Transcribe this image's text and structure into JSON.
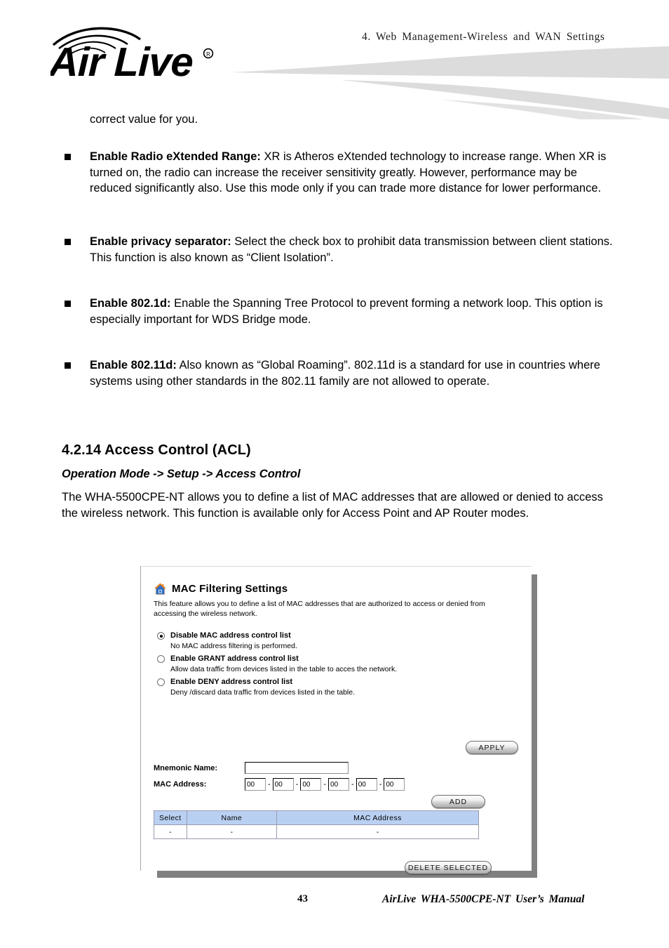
{
  "header": {
    "chapter_title": "4.  Web  Management-Wireless  and  WAN  Settings",
    "logo_text": "Air Live",
    "logo_mark": "registered-trademark"
  },
  "body": {
    "lead_paragraph": "correct value for you.",
    "bullets": [
      {
        "term": "Enable Radio eXtended Range",
        "separator": ":",
        "text": "   XR is Atheros eXtended technology to increase range.    When XR is turned on, the radio can increase the receiver sensitivity greatly. However, performance may be reduced significantly also.    Use this mode only if you can trade more distance for lower performance."
      },
      {
        "term": "Enable privacy separator:",
        "separator": "",
        "text": "   Select the check box to prohibit data transmission between client stations.    This function is also known as “Client Isolation”."
      },
      {
        "term": "Enable 802.1d:",
        "separator": "",
        "text": " Enable the Spanning Tree Protocol to prevent forming a network loop. This option is especially important for WDS Bridge mode."
      },
      {
        "term": "Enable 802.11d:",
        "separator": "",
        "text": "   Also known as “Global Roaming”.    802.11d is a standard for use in countries where systems using other standards in the 802.11 family are not allowed to operate."
      }
    ],
    "section_heading": "4.2.14 Access Control (ACL)",
    "section_subheading": "Operation Mode -> Setup -> Access Control",
    "section_paragraph": "The WHA-5500CPE-NT allows you to define a list of MAC addresses that are allowed or denied to access the wireless network.    This function is available only for Access Point and AP Router modes."
  },
  "screenshot": {
    "icon": "house-icon",
    "title": "MAC Filtering Settings",
    "description": "This feature allows you to define a list of MAC addresses that are authorized to access or denied from accessing the wireless network.",
    "radio_options": [
      {
        "label": "Disable MAC address control list",
        "sublabel": "No MAC address filtering is performed.",
        "selected": true
      },
      {
        "label": "Enable GRANT address control list",
        "sublabel": "Allow data traffic from devices listed in the table to acces the network.",
        "selected": false
      },
      {
        "label": "Enable DENY address control list",
        "sublabel": "Deny /discard data traffic from devices listed in the table.",
        "selected": false
      }
    ],
    "apply_button": "APPLY",
    "add_button": "ADD",
    "delete_button": "DELETE SELECTED",
    "fields": {
      "mnemonic_label": "Mnemonic Name:",
      "mnemonic_value": "",
      "mac_label": "MAC Address:",
      "mac_octets": [
        "00",
        "00",
        "00",
        "00",
        "00",
        "00"
      ],
      "mac_separator": "-"
    },
    "table": {
      "headers": [
        "Select",
        "Name",
        "MAC Address"
      ],
      "rows": [
        [
          "-",
          "-",
          "-"
        ]
      ]
    },
    "colors": {
      "table_header_bg": "#b9d0f2",
      "table_border": "#9a9ab0",
      "shadow": "#808080",
      "icon_roof": "#e8821e",
      "icon_body": "#2f6fc4"
    }
  },
  "footer": {
    "page_number": "43",
    "manual_title": "AirLive  WHA-5500CPE-NT  User’s  Manual"
  }
}
